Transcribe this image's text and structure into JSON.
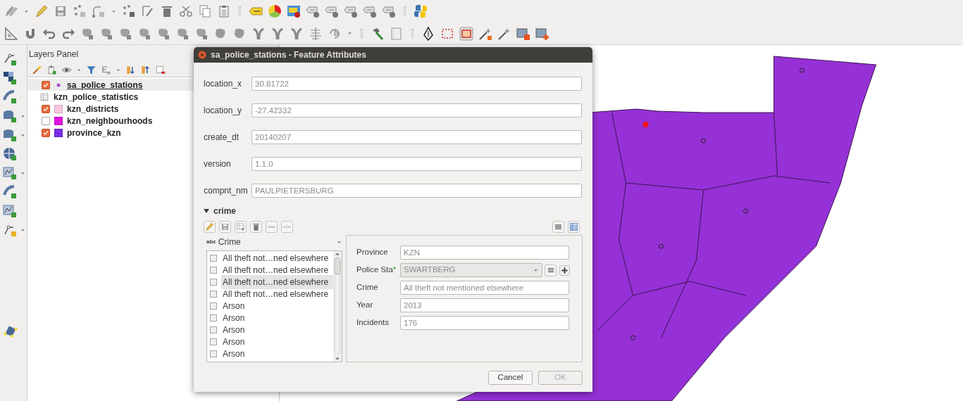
{
  "layers_panel": {
    "title": "Layers Panel",
    "layers": [
      {
        "name": "sa_police_stations",
        "kind": "point",
        "checked": true,
        "selected": true,
        "color": "#a64fc9"
      },
      {
        "name": "kzn_police_statistics",
        "kind": "table",
        "selected": false
      },
      {
        "name": "kzn_districts",
        "kind": "polygon",
        "checked": true,
        "selected": false,
        "color": "#f8c6e0"
      },
      {
        "name": "kzn_neighbourhoods",
        "kind": "polygon",
        "checked": false,
        "selected": false,
        "color": "#e014e0"
      },
      {
        "name": "province_kzn",
        "kind": "polygon",
        "checked": true,
        "selected": false,
        "color": "#7b2be8"
      }
    ]
  },
  "dialog": {
    "title": "sa_police_stations - Feature Attributes",
    "fields": [
      {
        "label": "location_x",
        "value": "30.81722"
      },
      {
        "label": "location_y",
        "value": "-27.42332"
      },
      {
        "label": "create_dt",
        "value": "20140207"
      },
      {
        "label": "version",
        "value": "1.1.0"
      },
      {
        "label": "compnt_nm",
        "value": "PAULPIETERSBURG"
      }
    ],
    "section": {
      "title": "crime",
      "expanded": true,
      "list_type": "abc",
      "list_header": "Crime",
      "items": [
        {
          "label": "All theft not…ned elsewhere",
          "checked": false,
          "selected": false
        },
        {
          "label": "All theft not…ned elsewhere",
          "checked": false,
          "selected": false
        },
        {
          "label": "All theft not…ned elsewhere",
          "checked": false,
          "selected": true
        },
        {
          "label": "All theft not…ned elsewhere",
          "checked": false,
          "selected": false
        },
        {
          "label": "Arson",
          "checked": false,
          "selected": false
        },
        {
          "label": "Arson",
          "checked": false,
          "selected": false
        },
        {
          "label": "Arson",
          "checked": false,
          "selected": false
        },
        {
          "label": "Arson",
          "checked": false,
          "selected": false
        },
        {
          "label": "Arson",
          "checked": false,
          "selected": false
        }
      ],
      "form": [
        {
          "kind": "text",
          "label": "Province",
          "value": "KZN"
        },
        {
          "kind": "combo",
          "label": "Police Sta",
          "required_mark": "*",
          "value": "SWARTBERG"
        },
        {
          "kind": "text",
          "label": "Crime",
          "value": "All theft not mentioned elsewhere"
        },
        {
          "kind": "text",
          "label": "Year",
          "value": "2013"
        },
        {
          "kind": "text",
          "label": "Incidents",
          "value": "176"
        }
      ]
    },
    "buttons": [
      {
        "label": "Cancel",
        "disabled": false
      },
      {
        "label": "OK",
        "disabled": true
      }
    ]
  }
}
